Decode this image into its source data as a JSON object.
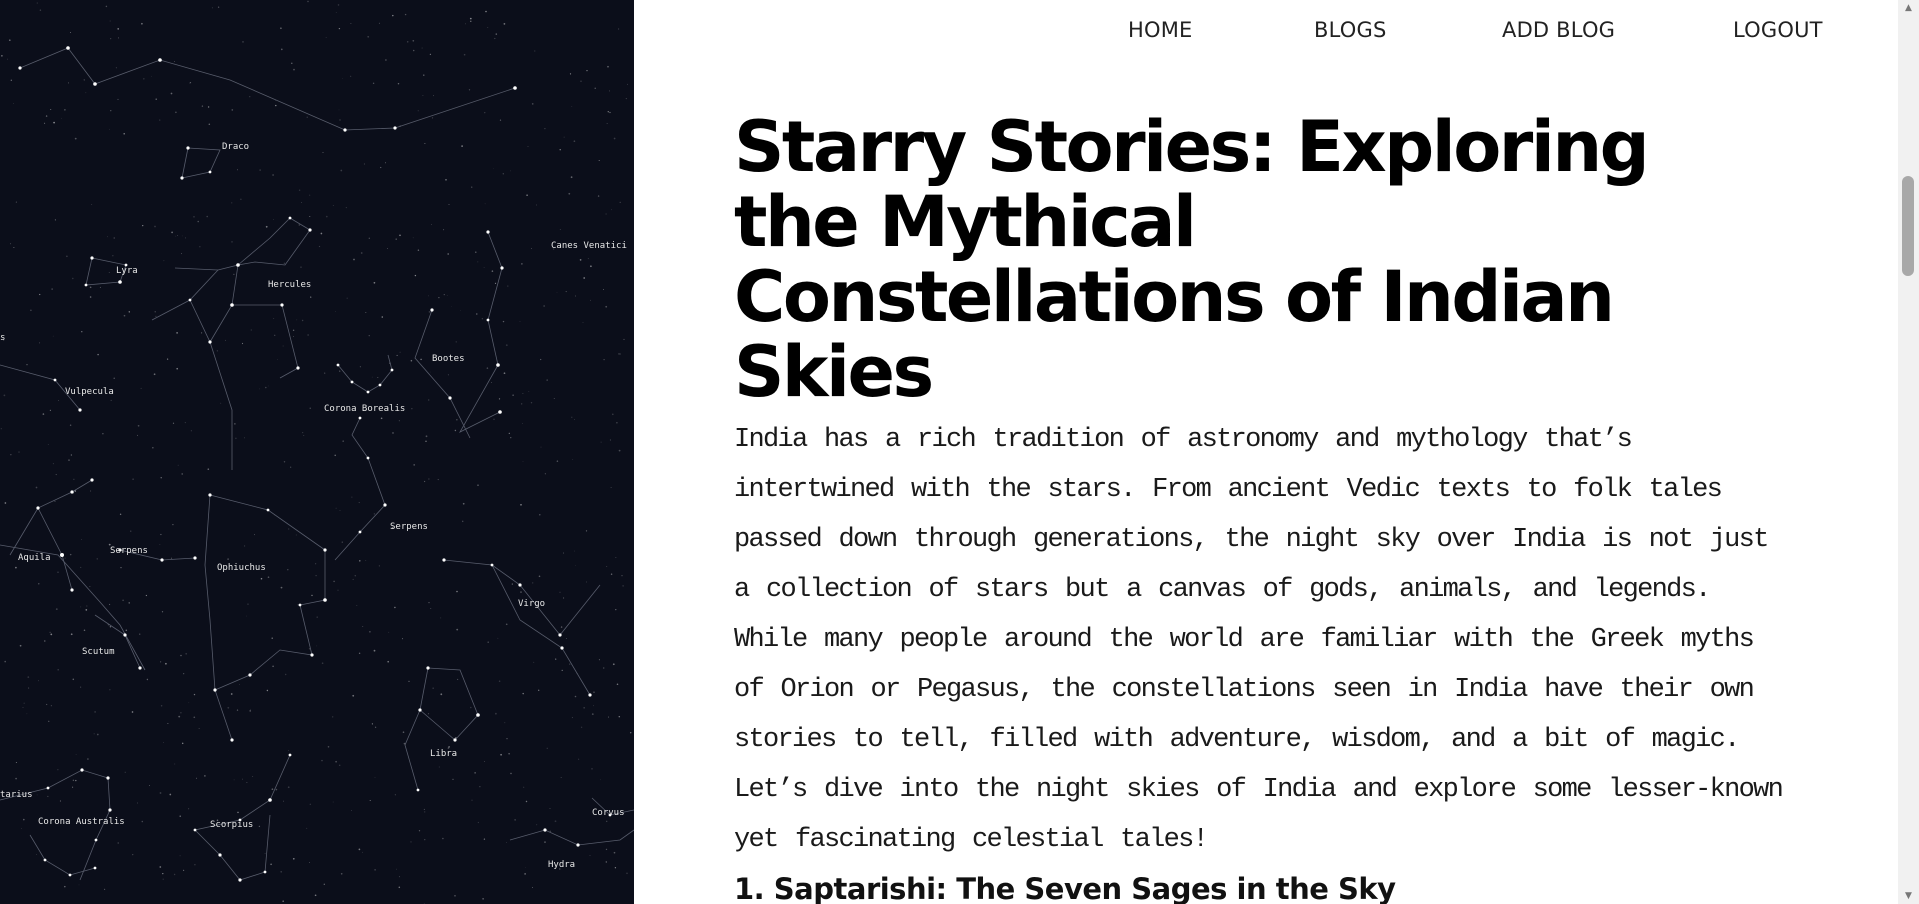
{
  "nav": {
    "items": [
      "HOME",
      "BLOGS",
      "ADD BLOG",
      "LOGOUT"
    ]
  },
  "article": {
    "title": "Starry Stories: Exploring the Mythical Constellations of Indian Skies",
    "intro": "India has a rich tradition of astronomy and mythology that’s intertwined with the stars. From ancient Vedic texts to folk tales passed down through generations, the night sky over India is not just a collection of stars but a canvas of gods, animals, and legends. While many people around the world are familiar with the Greek myths of Orion or Pegasus, the constellations seen in India have their own stories to tell, filled with adventure, wisdom, and a bit of magic. Let’s dive into the night skies of India and explore some lesser-known yet fascinating celestial tales!",
    "section_heading": "1. Saptarishi: The Seven Sages in the Sky"
  },
  "sky_map": {
    "constellation_labels": [
      "Draco",
      "Lyra",
      "Hercules",
      "Canes Venatici",
      "Vulpecula",
      "Bootes",
      "Corona Borealis",
      "Serpens",
      "Aquila",
      "Serpens",
      "Ophiuchus",
      "Virgo",
      "Scutum",
      "Libra",
      "Corona Australis",
      "Scorpius",
      "Corvus",
      "Hydra"
    ],
    "partial_labels": [
      "s",
      "tarius"
    ]
  },
  "colors": {
    "sky_background": "#0b0e1a",
    "star": "#ffffff",
    "constellation_line": "#6b7080",
    "text": "#000000"
  }
}
